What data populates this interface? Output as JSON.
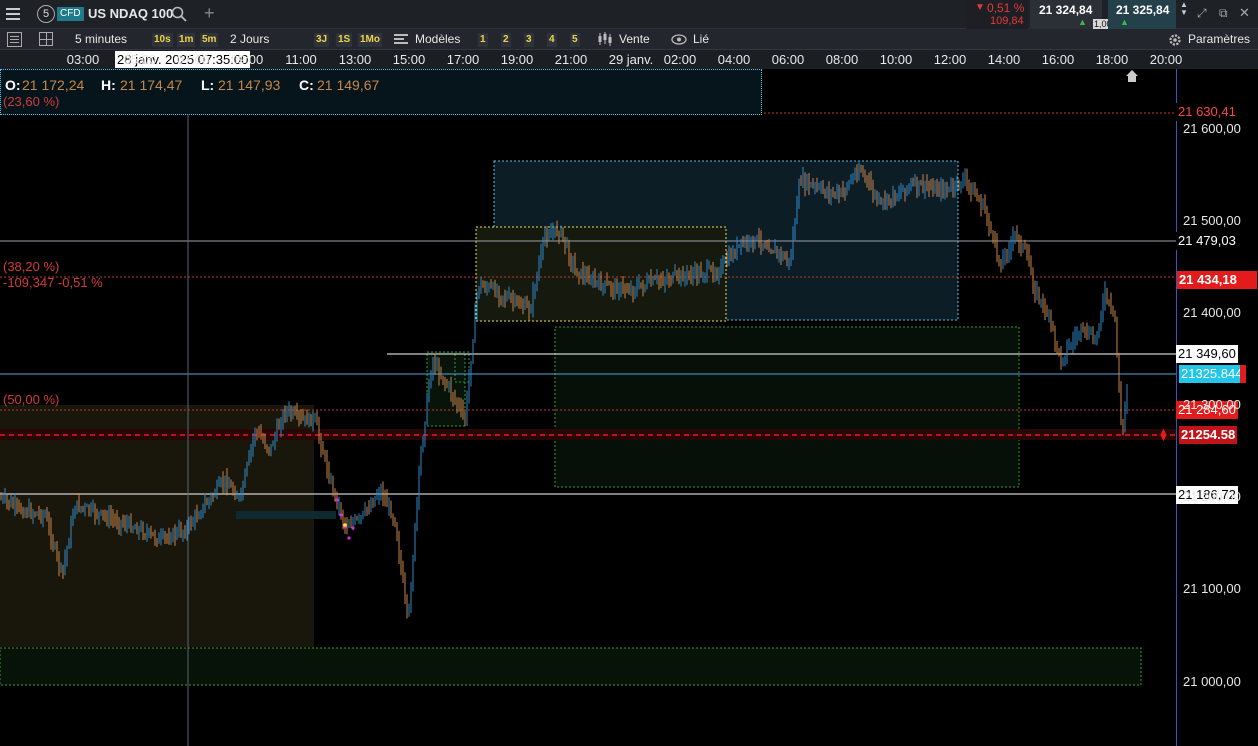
{
  "header": {
    "tab_number": "5",
    "instrument_type": "CFD",
    "instrument_name": "US NDAQ 100",
    "change_percent": "0,51 %",
    "change_value": "109,84",
    "bid": "21 324,84",
    "ask": "21 325,84",
    "spread": "1,00"
  },
  "toolbar": {
    "interval": "5 minutes",
    "interval_shortcuts": [
      "10s",
      "1m",
      "5m"
    ],
    "period": "2 Jours",
    "period_shortcuts": [
      "3J",
      "1S",
      "1Mo"
    ],
    "models_label": "Modèles",
    "model_slots": [
      "1",
      "2",
      "3",
      "4",
      "5"
    ],
    "side_label": "Vente",
    "linked_label": "Lié",
    "settings_label": "Paramètres"
  },
  "time_axis": {
    "labels": [
      "03:00",
      "05:00",
      "07:00",
      "09:00",
      "11:00",
      "13:00",
      "15:00",
      "17:00",
      "19:00",
      "21:00",
      "29 janv.",
      "02:00",
      "04:00",
      "06:00",
      "08:00",
      "10:00",
      "12:00",
      "14:00",
      "16:00",
      "18:00",
      "20:00"
    ],
    "crosshair_label": "28 janv. 2025 07:35:00"
  },
  "ohlc": {
    "open_label": "O:",
    "open": "21 172,24",
    "high_label": "H:",
    "high": "21 174,47",
    "low_label": "L:",
    "low": "21 147,93",
    "close_label": "C:",
    "close": "21 149,67"
  },
  "fib_labels": {
    "f236": "(23,60 %)",
    "f382": "(38,20 %)",
    "f382_change": "-109,347 -0,51 %",
    "f500": "(50,00 %)"
  },
  "price_axis": {
    "labels": [
      "21 600,00",
      "21 500,00",
      "21 400,00",
      "21 300,00",
      "21 200,00",
      "21 100,00",
      "21 000,00"
    ],
    "price_min": 20930,
    "price_max": 21665,
    "tags": {
      "t1": "21 630,41",
      "t2": "21 479,03",
      "t3": "21 434,18",
      "t4": "21 349,60",
      "t5": "21325.844",
      "t6": "21 284,60",
      "t7": "21254.58",
      "t8": "21 186,72"
    }
  },
  "colors": {
    "bull": "#2f88c8",
    "bear": "#c8844a",
    "fib_line": "#c0392b",
    "price_tag_red": "#e31b1b",
    "cyan_tag": "#21c6e8",
    "background": "#000000"
  }
}
